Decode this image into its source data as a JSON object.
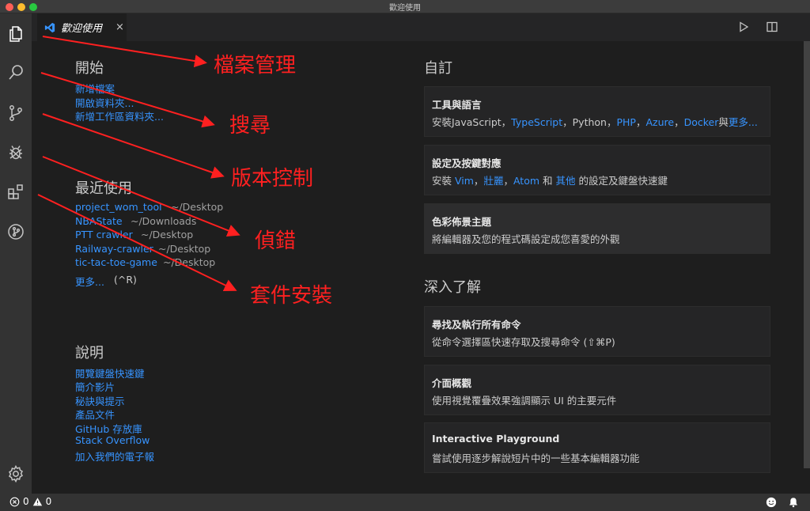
{
  "window": {
    "title": "歡迎使用"
  },
  "tab": {
    "label": "歡迎使用",
    "close": "×"
  },
  "start": {
    "title": "開始",
    "links": [
      "新增檔案",
      "開啟資料夾...",
      "新增工作區資料夾..."
    ]
  },
  "recent": {
    "title": "最近使用",
    "items": [
      {
        "name": "project_wom_tool",
        "path": "~/Desktop"
      },
      {
        "name": "NBAState",
        "path": "~/Downloads"
      },
      {
        "name": "PTT crawler",
        "path": "~/Desktop"
      },
      {
        "name": "Railway-crawler",
        "path": "~/Desktop"
      },
      {
        "name": "tic-tac-toe-game",
        "path": "~/Desktop"
      }
    ],
    "more": "更多...",
    "more_shortcut": "(^R)"
  },
  "help": {
    "title": "說明",
    "links": [
      "閱覽鍵盤快速鍵",
      "簡介影片",
      "秘訣與提示",
      "產品文件",
      "GitHub 存放庫",
      "Stack Overflow",
      "加入我們的電子報"
    ]
  },
  "customize": {
    "title": "自訂",
    "tools": {
      "title": "工具與語言",
      "prefix": "安裝JavaScript，",
      "ts": "TypeScript",
      "sep1": "，Python，",
      "php": "PHP",
      "sep2": "，",
      "azure": "Azure",
      "sep3": "，",
      "docker": "Docker",
      "sep4": "與",
      "more": "更多..."
    },
    "keymaps": {
      "title": "設定及按鍵對應",
      "prefix": "安裝 ",
      "vim": "Vim",
      "sep1": "，",
      "sublime": "壯麗",
      "sep2": "，",
      "atom": "Atom",
      "sep3": " 和 ",
      "other": "其他",
      "suffix": " 的設定及鍵盤快速鍵"
    },
    "theme": {
      "title": "色彩佈景主題",
      "desc": "將編輯器及您的程式碼設定成您喜愛的外觀"
    }
  },
  "learn": {
    "title": "深入了解",
    "cards": [
      {
        "title": "尋找及執行所有命令",
        "desc": "從命令選擇區快速存取及搜尋命令 (⇧⌘P)"
      },
      {
        "title": "介面概觀",
        "desc": "使用視覺覆疊效果強調顯示 UI 的主要元件"
      },
      {
        "title": "Interactive Playground",
        "desc": "嘗試使用逐步解說短片中的一些基本編輯器功能"
      }
    ]
  },
  "annotations": {
    "explorer": "檔案管理",
    "search": "搜尋",
    "scm": "版本控制",
    "debug": "偵錯",
    "extensions": "套件安裝"
  },
  "status": {
    "errors": "0",
    "warnings": "0"
  },
  "colors": {
    "link": "#3794ff",
    "annotation": "#ff2020",
    "activitybar": "#333333",
    "editor": "#1e1e1e"
  },
  "icons": {
    "activity": [
      "files-icon",
      "search-icon",
      "source-control-icon",
      "debug-icon",
      "extensions-icon",
      "git-graph-icon"
    ],
    "settings": "gear-icon"
  }
}
